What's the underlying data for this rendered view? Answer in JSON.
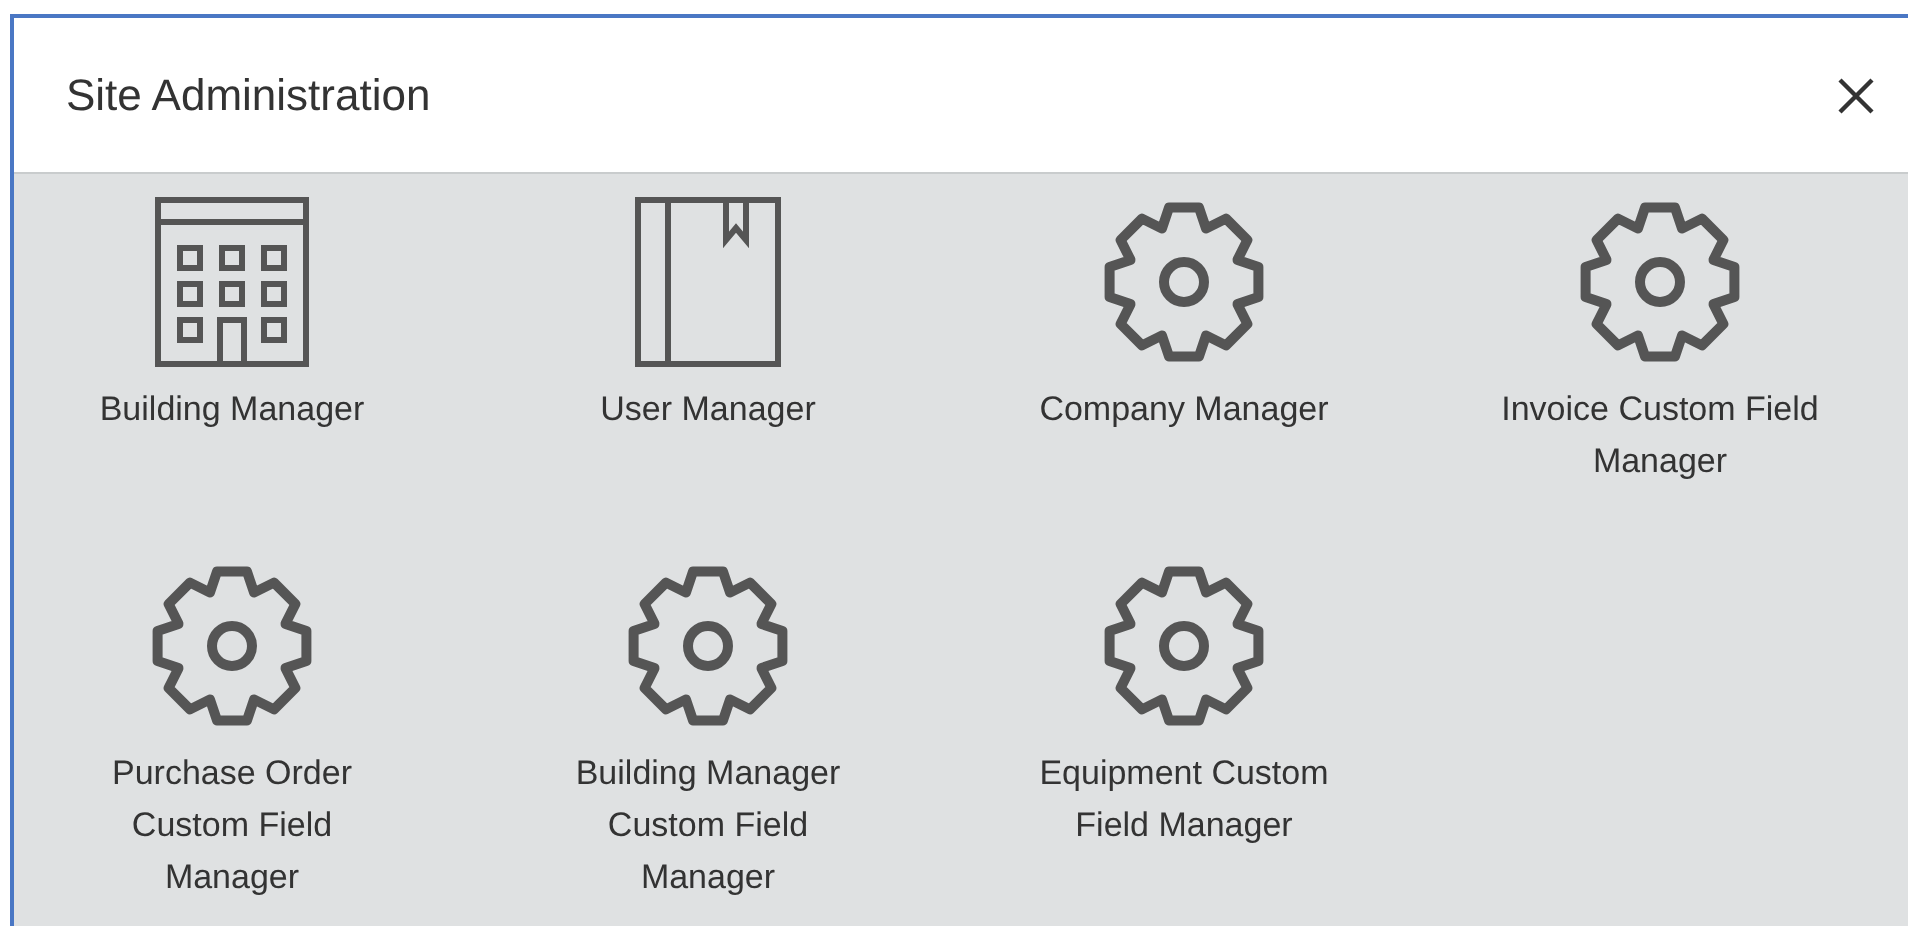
{
  "dialog": {
    "title": "Site Administration"
  },
  "tiles": [
    {
      "kind": "building",
      "label": "Building Manager"
    },
    {
      "kind": "book",
      "label": "User Manager"
    },
    {
      "kind": "gear",
      "label": "Company Manager"
    },
    {
      "kind": "gear",
      "label": "Invoice Custom Field\nManager"
    },
    {
      "kind": "gear",
      "label": "Purchase Order\nCustom Field\nManager"
    },
    {
      "kind": "gear",
      "label": "Building Manager\nCustom Field\nManager"
    },
    {
      "kind": "gear",
      "label": "Equipment Custom\nField Manager"
    }
  ]
}
